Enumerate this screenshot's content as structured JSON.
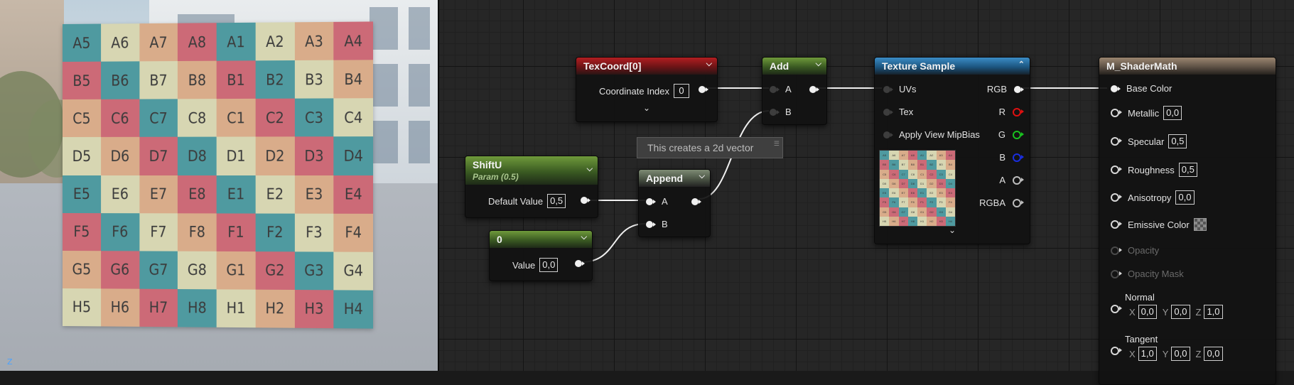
{
  "viewport": {
    "axis_label": "Z",
    "checker_labels": [
      [
        "A5",
        "A6",
        "A7",
        "A8",
        "A1",
        "A2",
        "A3",
        "A4"
      ],
      [
        "B5",
        "B6",
        "B7",
        "B8",
        "B1",
        "B2",
        "B3",
        "B4"
      ],
      [
        "C5",
        "C6",
        "C7",
        "C8",
        "C1",
        "C2",
        "C3",
        "C4"
      ],
      [
        "D5",
        "D6",
        "D7",
        "D8",
        "D1",
        "D2",
        "D3",
        "D4"
      ],
      [
        "E5",
        "E6",
        "E7",
        "E8",
        "E1",
        "E2",
        "E3",
        "E4"
      ],
      [
        "F5",
        "F6",
        "F7",
        "F8",
        "F1",
        "F2",
        "F3",
        "F4"
      ],
      [
        "G5",
        "G6",
        "G7",
        "G8",
        "G1",
        "G2",
        "G3",
        "G4"
      ],
      [
        "H5",
        "H6",
        "H7",
        "H8",
        "H1",
        "H2",
        "H3",
        "H4"
      ]
    ],
    "checker_colors": [
      [
        "#4f9aa0",
        "#d7d6b2",
        "#d9ac8a",
        "#cc6a77",
        "#4f9aa0",
        "#d7d6b2",
        "#d9ac8a",
        "#cc6a77"
      ],
      [
        "#cc6a77",
        "#4f9aa0",
        "#d7d6b2",
        "#d9ac8a",
        "#cc6a77",
        "#4f9aa0",
        "#d7d6b2",
        "#d9ac8a"
      ],
      [
        "#d9ac8a",
        "#cc6a77",
        "#4f9aa0",
        "#d7d6b2",
        "#d9ac8a",
        "#cc6a77",
        "#4f9aa0",
        "#d7d6b2"
      ],
      [
        "#d7d6b2",
        "#d9ac8a",
        "#cc6a77",
        "#4f9aa0",
        "#d7d6b2",
        "#d9ac8a",
        "#cc6a77",
        "#4f9aa0"
      ],
      [
        "#4f9aa0",
        "#d7d6b2",
        "#d9ac8a",
        "#cc6a77",
        "#4f9aa0",
        "#d7d6b2",
        "#d9ac8a",
        "#cc6a77"
      ],
      [
        "#cc6a77",
        "#4f9aa0",
        "#d7d6b2",
        "#d9ac8a",
        "#cc6a77",
        "#4f9aa0",
        "#d7d6b2",
        "#d9ac8a"
      ],
      [
        "#d9ac8a",
        "#cc6a77",
        "#4f9aa0",
        "#d7d6b2",
        "#d9ac8a",
        "#cc6a77",
        "#4f9aa0",
        "#d7d6b2"
      ],
      [
        "#d7d6b2",
        "#d9ac8a",
        "#cc6a77",
        "#4f9aa0",
        "#d7d6b2",
        "#d9ac8a",
        "#cc6a77",
        "#4f9aa0"
      ]
    ]
  },
  "nodes": {
    "texcoord": {
      "title": "TexCoord[0]",
      "row_label": "Coordinate Index",
      "row_value": "0"
    },
    "add": {
      "title": "Add",
      "pin_a": "A",
      "pin_b": "B"
    },
    "comment": {
      "text": "This creates a 2d vector"
    },
    "shiftu": {
      "title": "ShiftU",
      "subtitle": "Param (0.5)",
      "row_label": "Default Value",
      "row_value": "0,5"
    },
    "append": {
      "title": "Append",
      "pin_a": "A",
      "pin_b": "B"
    },
    "const0": {
      "title": "0",
      "row_label": "Value",
      "row_value": "0,0"
    },
    "texsample": {
      "title": "Texture Sample",
      "inputs": [
        "UVs",
        "Tex",
        "Apply View MipBias"
      ],
      "outputs": [
        "RGB",
        "R",
        "G",
        "B",
        "A",
        "RGBA"
      ]
    },
    "material": {
      "title": "M_ShaderMath",
      "base_color": "Base Color",
      "metallic": "Metallic",
      "metallic_value": "0,0",
      "specular": "Specular",
      "specular_value": "0,5",
      "roughness": "Roughness",
      "roughness_value": "0,5",
      "anisotropy": "Anisotropy",
      "anisotropy_value": "0,0",
      "emissive": "Emissive Color",
      "opacity": "Opacity",
      "opacity_mask": "Opacity Mask",
      "normal": "Normal",
      "normal_values": {
        "x": "0,0",
        "y": "0,0",
        "z": "1,0"
      },
      "tangent": "Tangent",
      "tangent_values": {
        "x": "1,0",
        "y": "0,0",
        "z": "0,0"
      },
      "axis_x": "X",
      "axis_y": "Y",
      "axis_z": "Z"
    }
  }
}
